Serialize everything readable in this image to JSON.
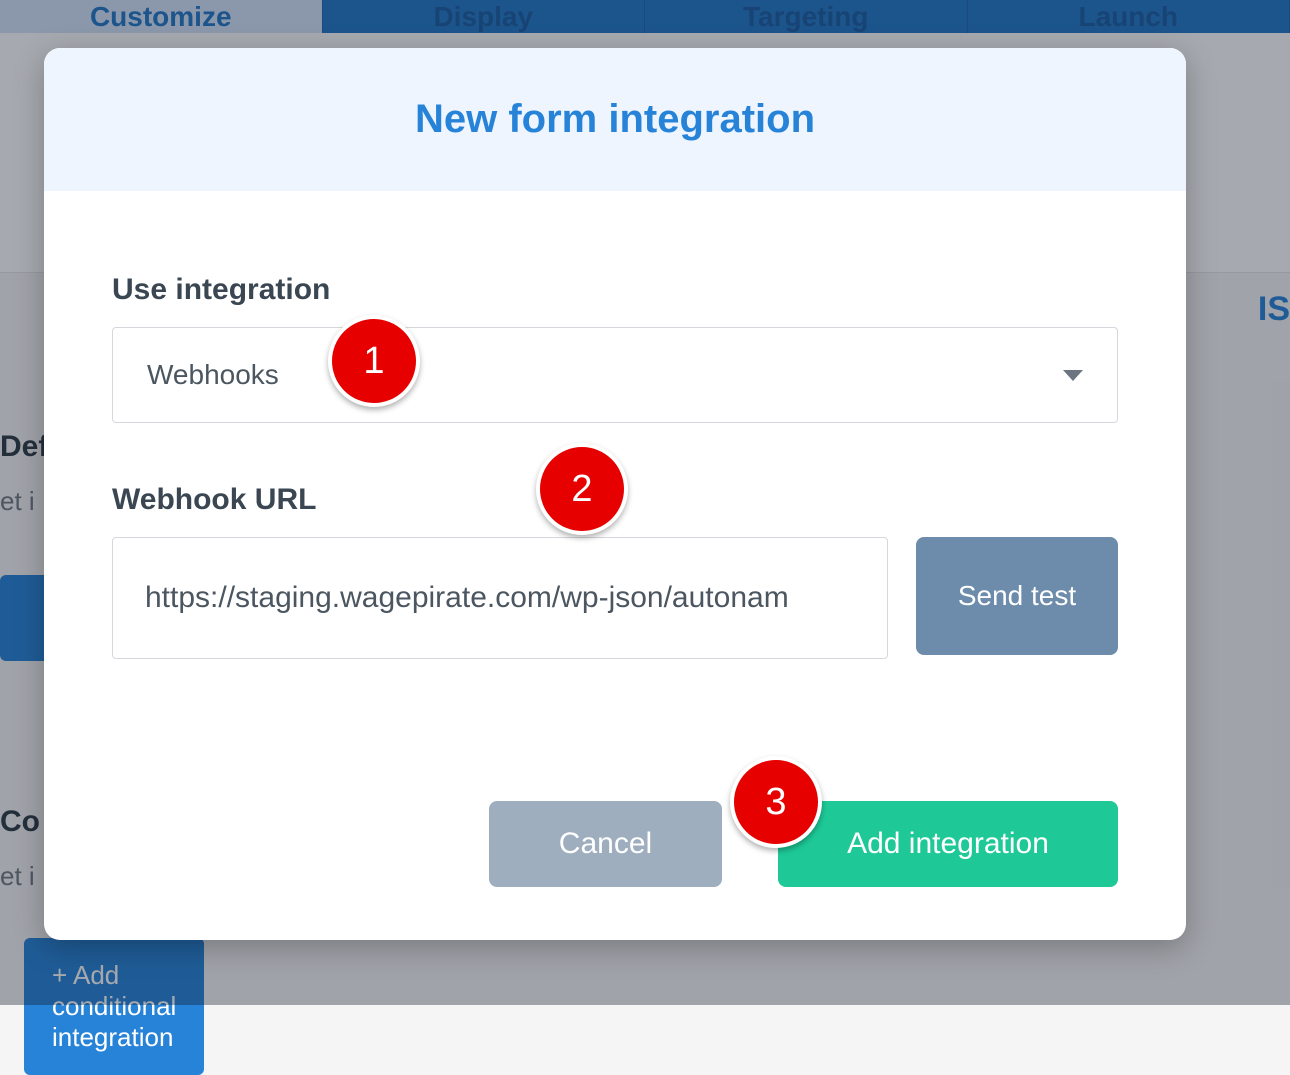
{
  "background": {
    "tabs": [
      "Customize",
      "Display",
      "Targeting",
      "Launch"
    ],
    "side_label_fragment": "IS",
    "def_heading_fragment": "Def",
    "def_sub_fragment": "et i",
    "cond_heading_fragment": "Co",
    "cond_sub_fragment": "et i",
    "cond_button": "+ Add conditional integration"
  },
  "modal": {
    "title": "New form integration",
    "use_integration_label": "Use integration",
    "integration_value": "Webhooks",
    "webhook_url_label": "Webhook URL",
    "webhook_url_value": "https://staging.wagepirate.com/wp-json/autonam",
    "send_test_label": "Send test",
    "cancel_label": "Cancel",
    "add_label": "Add integration"
  },
  "annotations": {
    "one": "1",
    "two": "2",
    "three": "3"
  }
}
